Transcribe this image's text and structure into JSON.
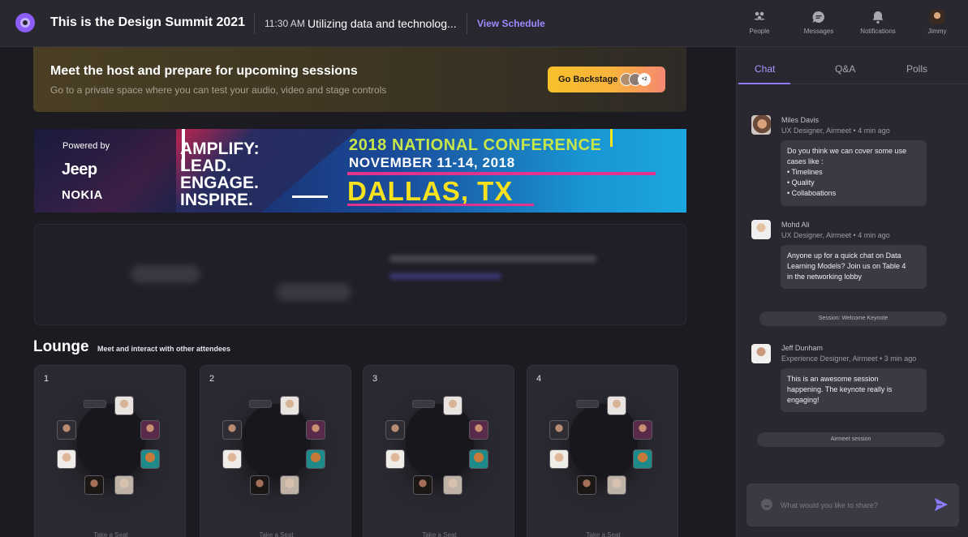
{
  "header": {
    "event_title": "This is the Design Summit 2021",
    "session_time": "11:30 AM",
    "session_title": "Utilizing data and technolog...",
    "view_schedule": "View Schedule",
    "nav": [
      {
        "label": "People",
        "icon": "people-icon"
      },
      {
        "label": "Messages",
        "icon": "message-icon"
      },
      {
        "label": "Notifications",
        "icon": "bell-icon"
      },
      {
        "label": "Jimmy",
        "icon": "avatar"
      }
    ]
  },
  "host_banner": {
    "title": "Meet the host and prepare for upcoming sessions",
    "subtitle": "Go to a private space where you can test your audio, video and stage controls",
    "button_label": "Go Backstage",
    "extra_count": "+2"
  },
  "sponsor": {
    "powered_by": "Powered by",
    "sponsor_1": "Jeep",
    "sponsor_2": "NOKIA",
    "tagline": "AMPLIFY:\nLEAD.\nENGAGE.\nINSPIRE.",
    "conference_line_1": "2018 NATIONAL CONFERENCE",
    "conference_line_2": "NOVEMBER 11-14, 2018",
    "conference_city": "DALLAS, TX"
  },
  "lounge": {
    "title": "Lounge",
    "subtitle": "Meet and interact with other attendees",
    "tables": [
      {
        "number": "1",
        "action": "Take a Seat"
      },
      {
        "number": "2",
        "action": "Take a Seat"
      },
      {
        "number": "3",
        "action": "Take a Seat"
      },
      {
        "number": "4",
        "action": "Take a Seat"
      }
    ]
  },
  "sidebar": {
    "tabs": [
      "Chat",
      "Q&A",
      "Polls"
    ],
    "active_tab": "Chat",
    "messages": [
      {
        "name": "Miles Davis",
        "meta": "UX Designer, Airmeet • 4 min ago",
        "lines": [
          "Do you think we can cover some use",
          "cases like :",
          "• Timelines",
          "• Quality",
          "• Collaboations"
        ]
      },
      {
        "name": "Mohd Ali",
        "meta": "UX Designer, Airmeet • 4 min ago",
        "lines": [
          "Anyone up for a quick chat on Data",
          "Learning Models? Join us on Table 4",
          "in the networking lobby"
        ]
      },
      {
        "name": "Jeff Dunham",
        "meta": "Experience Designer, Airmeet • 3 min ago",
        "lines": [
          "This is an awesome session",
          "happening. The keynote really is",
          "engaging!"
        ]
      }
    ],
    "session_pills": [
      "Session: Welcome Keynote",
      "Airmeet session"
    ],
    "composer_placeholder": "What would you like to share?"
  },
  "colors": {
    "accent": "#8b7cff",
    "background": "#1c1b22",
    "panel": "#29272f",
    "backstage_gradient_start": "#f8c02b",
    "backstage_gradient_end": "#f48872"
  }
}
